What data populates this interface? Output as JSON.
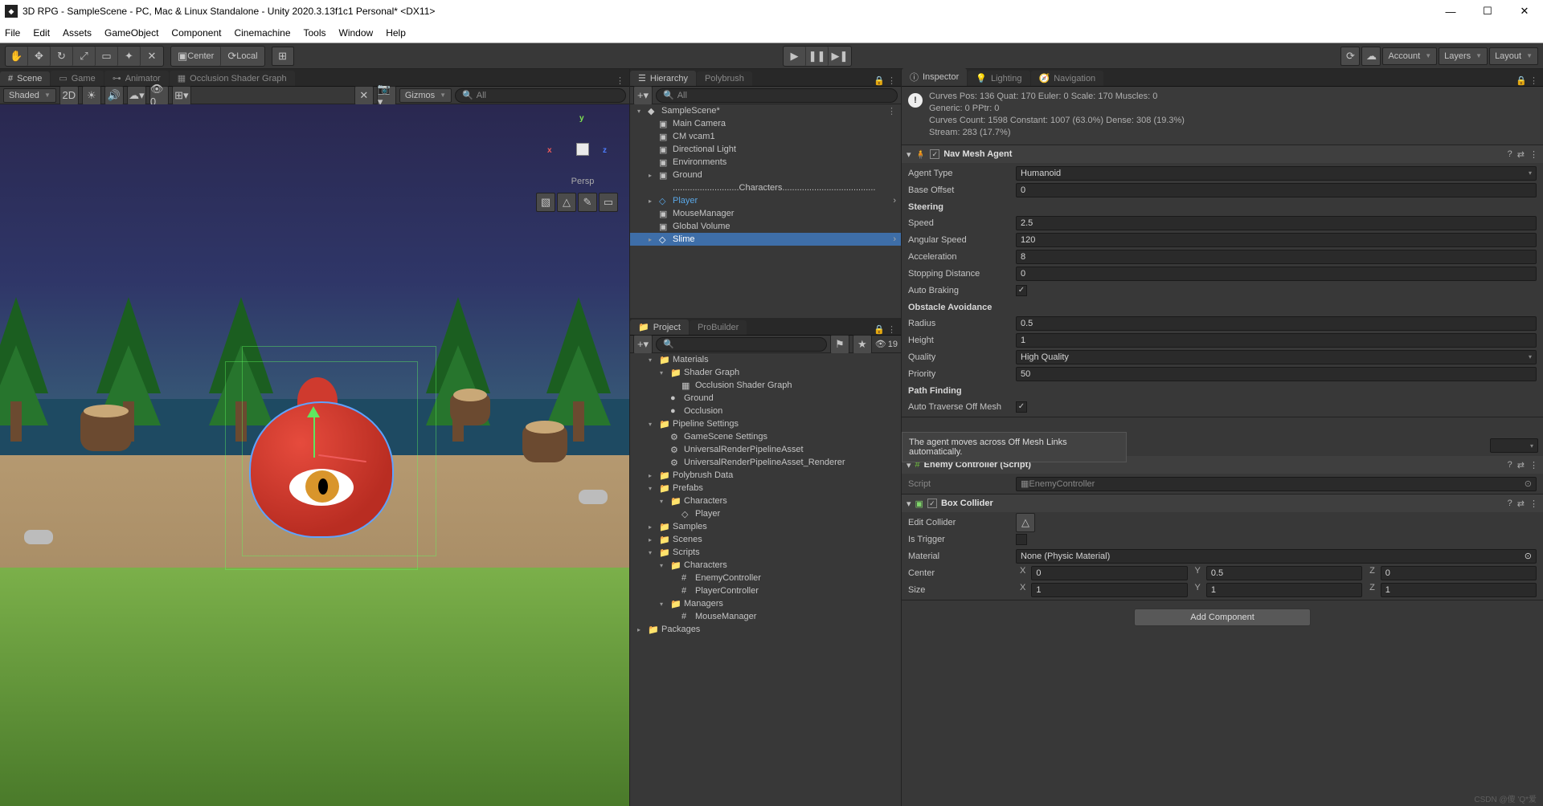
{
  "window": {
    "title": "3D RPG - SampleScene - PC, Mac & Linux Standalone - Unity 2020.3.13f1c1 Personal* <DX11>",
    "min": "—",
    "max": "☐",
    "close": "✕"
  },
  "menu": [
    "File",
    "Edit",
    "Assets",
    "GameObject",
    "Component",
    "Cinemachine",
    "Tools",
    "Window",
    "Help"
  ],
  "toolbar": {
    "center": "Center",
    "local": "Local",
    "account": "Account",
    "layers": "Layers",
    "layout": "Layout"
  },
  "sceneTabs": {
    "scene": "Scene",
    "game": "Game",
    "animator": "Animator",
    "osg": "Occlusion Shader Graph"
  },
  "sceneCtl": {
    "shaded": "Shaded",
    "twoD": "2D",
    "gizmos": "Gizmos",
    "searchAll": "All",
    "persp": "Persp",
    "axes": {
      "x": "x",
      "y": "y",
      "z": "z"
    }
  },
  "midTabs": {
    "hierarchy": "Hierarchy",
    "polybrush": "Polybrush",
    "project": "Project",
    "probuilder": "ProBuilder"
  },
  "hierarchy": {
    "searchAll": "All",
    "items": [
      {
        "ind": 0,
        "fold": "▾",
        "ico": "◆",
        "label": "SampleScene*",
        "opts": true
      },
      {
        "ind": 1,
        "fold": "",
        "ico": "▣",
        "label": "Main Camera"
      },
      {
        "ind": 1,
        "fold": "",
        "ico": "▣",
        "label": "CM vcam1"
      },
      {
        "ind": 1,
        "fold": "",
        "ico": "▣",
        "label": "Directional Light"
      },
      {
        "ind": 1,
        "fold": "",
        "ico": "▣",
        "label": "Environments"
      },
      {
        "ind": 1,
        "fold": "▸",
        "ico": "▣",
        "label": "Ground"
      },
      {
        "ind": 1,
        "fold": "",
        "ico": "",
        "label": "...........................Characters......................................"
      },
      {
        "ind": 1,
        "fold": "▸",
        "ico": "◇",
        "label": "Player",
        "cls": "player-ref",
        "chev": true
      },
      {
        "ind": 1,
        "fold": "",
        "ico": "▣",
        "label": "MouseManager"
      },
      {
        "ind": 1,
        "fold": "",
        "ico": "▣",
        "label": "Global Volume"
      },
      {
        "ind": 1,
        "fold": "▸",
        "ico": "◇",
        "label": "Slime",
        "sel": true,
        "chev": true
      }
    ]
  },
  "project": {
    "count": "19",
    "items": [
      {
        "ind": 1,
        "fold": "▾",
        "ico": "📁",
        "label": "Materials"
      },
      {
        "ind": 2,
        "fold": "▾",
        "ico": "📁",
        "label": "Shader Graph"
      },
      {
        "ind": 3,
        "fold": "",
        "ico": "▦",
        "label": "Occlusion Shader Graph"
      },
      {
        "ind": 2,
        "fold": "",
        "ico": "●",
        "label": "Ground"
      },
      {
        "ind": 2,
        "fold": "",
        "ico": "●",
        "label": "Occlusion"
      },
      {
        "ind": 1,
        "fold": "▾",
        "ico": "📁",
        "label": "Pipeline Settings"
      },
      {
        "ind": 2,
        "fold": "",
        "ico": "⚙",
        "label": "GameScene Settings"
      },
      {
        "ind": 2,
        "fold": "",
        "ico": "⚙",
        "label": "UniversalRenderPipelineAsset"
      },
      {
        "ind": 2,
        "fold": "",
        "ico": "⚙",
        "label": "UniversalRenderPipelineAsset_Renderer"
      },
      {
        "ind": 1,
        "fold": "▸",
        "ico": "📁",
        "label": "Polybrush Data"
      },
      {
        "ind": 1,
        "fold": "▾",
        "ico": "📁",
        "label": "Prefabs"
      },
      {
        "ind": 2,
        "fold": "▾",
        "ico": "📁",
        "label": "Characters"
      },
      {
        "ind": 3,
        "fold": "",
        "ico": "◇",
        "label": "Player"
      },
      {
        "ind": 1,
        "fold": "▸",
        "ico": "📁",
        "label": "Samples"
      },
      {
        "ind": 1,
        "fold": "▸",
        "ico": "📁",
        "label": "Scenes"
      },
      {
        "ind": 1,
        "fold": "▾",
        "ico": "📁",
        "label": "Scripts"
      },
      {
        "ind": 2,
        "fold": "▾",
        "ico": "📁",
        "label": "Characters"
      },
      {
        "ind": 3,
        "fold": "",
        "ico": "#",
        "label": "EnemyController"
      },
      {
        "ind": 3,
        "fold": "",
        "ico": "#",
        "label": "PlayerController"
      },
      {
        "ind": 2,
        "fold": "▾",
        "ico": "📁",
        "label": "Managers"
      },
      {
        "ind": 3,
        "fold": "",
        "ico": "#",
        "label": "MouseManager"
      },
      {
        "ind": 0,
        "fold": "▸",
        "ico": "📁",
        "label": "Packages"
      }
    ]
  },
  "inspTabs": {
    "inspector": "Inspector",
    "lighting": "Lighting",
    "navigation": "Navigation"
  },
  "stats": {
    "l1": "Curves Pos: 136 Quat: 170 Euler: 0 Scale: 170 Muscles: 0",
    "l2": "Generic: 0 PPtr: 0",
    "l3": "Curves Count: 1598 Constant: 1007 (63.0%) Dense: 308 (19.3%)",
    "l4": "Stream: 283 (17.7%)"
  },
  "navAgent": {
    "title": "Nav Mesh Agent",
    "agentType": {
      "label": "Agent Type",
      "value": "Humanoid"
    },
    "baseOffset": {
      "label": "Base Offset",
      "value": "0"
    },
    "steering": "Steering",
    "speed": {
      "label": "Speed",
      "value": "2.5"
    },
    "angular": {
      "label": "Angular Speed",
      "value": "120"
    },
    "accel": {
      "label": "Acceleration",
      "value": "8"
    },
    "stop": {
      "label": "Stopping Distance",
      "value": "0"
    },
    "autoBrake": {
      "label": "Auto Braking",
      "checked": "✓"
    },
    "obstacle": "Obstacle Avoidance",
    "radius": {
      "label": "Radius",
      "value": "0.5"
    },
    "height": {
      "label": "Height",
      "value": "1"
    },
    "quality": {
      "label": "Quality",
      "value": "High Quality"
    },
    "priority": {
      "label": "Priority",
      "value": "50"
    },
    "pathfinding": "Path Finding",
    "autoTraverse": {
      "label": "Auto Traverse Off Mesh",
      "checked": "✓"
    },
    "tooltip": "The agent moves across Off Mesh Links automatically."
  },
  "enemyCtl": {
    "title": "Enemy Controller (Script)",
    "script": {
      "label": "Script",
      "value": "EnemyController"
    }
  },
  "boxCol": {
    "title": "Box Collider",
    "edit": {
      "label": "Edit Collider"
    },
    "trigger": {
      "label": "Is Trigger"
    },
    "material": {
      "label": "Material",
      "value": "None (Physic Material)"
    },
    "center": {
      "label": "Center",
      "x": "0",
      "y": "0.5",
      "z": "0"
    },
    "size": {
      "label": "Size",
      "x": "1",
      "y": "1",
      "z": "1"
    }
  },
  "addComp": "Add Component",
  "watermark": "CSDN @傻 'Q*爱"
}
